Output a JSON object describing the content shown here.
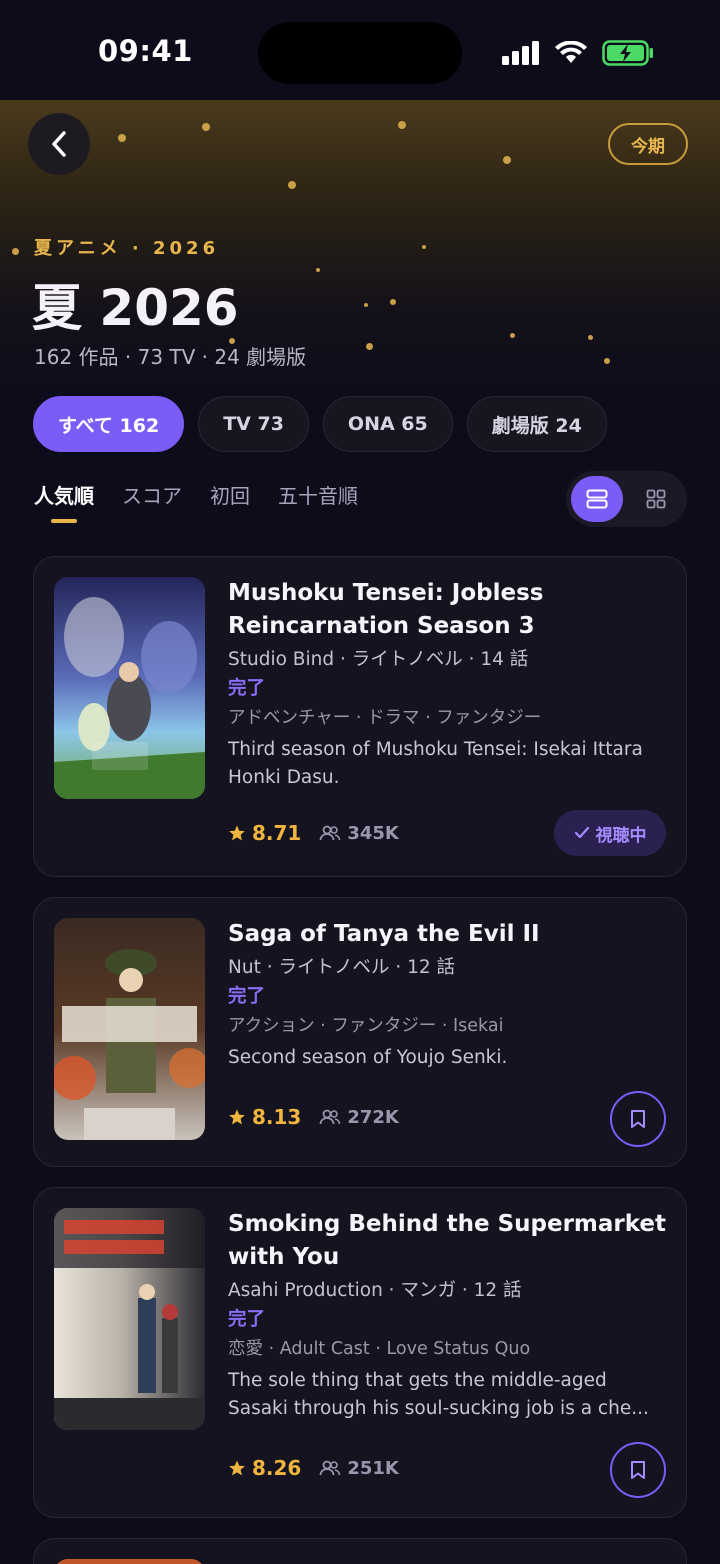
{
  "status_bar": {
    "time": "09:41"
  },
  "header": {
    "season_pill": "今期",
    "eyebrow": "夏アニメ · 2026",
    "title": "夏 2026",
    "subtitle": "162 作品 · 73 TV · 24 劇場版"
  },
  "filters": [
    {
      "label": "すべて 162",
      "active": true
    },
    {
      "label": "TV 73",
      "active": false
    },
    {
      "label": "ONA 65",
      "active": false
    },
    {
      "label": "劇場版 24",
      "active": false
    }
  ],
  "sort_tabs": [
    {
      "label": "人気順",
      "active": true
    },
    {
      "label": "スコア",
      "active": false
    },
    {
      "label": "初回",
      "active": false
    },
    {
      "label": "五十音順",
      "active": false
    }
  ],
  "view_mode": "list",
  "cards": [
    {
      "title": "Mushoku Tensei: Jobless Reincarnation Season 3",
      "meta": "Studio Bind · ライトノベル · 14 話",
      "status": "完了",
      "genres": "アドベンチャー · ドラマ · ファンタジー",
      "description": "Third season of Mushoku Tensei: Isekai Ittara Honki Dasu.",
      "score": "8.71",
      "members": "345K",
      "action_label": "視聴中",
      "action": "watching"
    },
    {
      "title": "Saga of Tanya the Evil II",
      "meta": "Nut · ライトノベル · 12 話",
      "status": "完了",
      "genres": "アクション · ファンタジー · Isekai",
      "description": "Second season of Youjo Senki.",
      "score": "8.13",
      "members": "272K",
      "action": "bookmark"
    },
    {
      "title": "Smoking Behind the Supermarket with You",
      "meta": "Asahi Production · マンガ · 12 話",
      "status": "完了",
      "genres": "恋愛 · Adult Cast · Love Status Quo",
      "description": "The sole thing that gets the middle-aged Sasaki through his soul-sucking job is a che...",
      "score": "8.26",
      "members": "251K",
      "action": "bookmark"
    }
  ],
  "colors": {
    "accent": "#7c5cf6",
    "gold": "#e8b54c",
    "background": "#0d0c1a",
    "card": "#15131f"
  },
  "icons": [
    "back-chevron-icon",
    "star-icon",
    "members-icon",
    "check-icon",
    "bookmark-icon",
    "list-view-icon",
    "grid-view-icon"
  ]
}
